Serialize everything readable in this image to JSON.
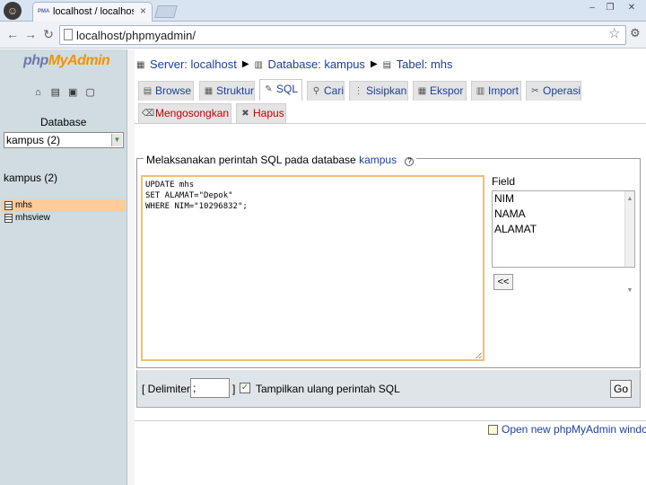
{
  "browser": {
    "tab_title": "localhost / localhost / kampus",
    "favicon_text": "PMA",
    "address": "localhost/phpmyadmin/",
    "tab_close": "×",
    "window_controls": [
      "–",
      "❐",
      "✕"
    ]
  },
  "sidebar": {
    "logo_php": "php",
    "logo_myadmin": "MyAdmin",
    "icons": [
      "home-icon",
      "sql-window-icon",
      "docs-icon",
      "query-icon"
    ],
    "database_label": "Database",
    "selected_database": "kampus (2)",
    "database_title": "kampus (2)",
    "tables": [
      {
        "name": "mhs",
        "active": true
      },
      {
        "name": "mhsview",
        "active": false
      }
    ]
  },
  "breadcrumb": {
    "server": "Server: localhost",
    "database": "Database: kampus",
    "table": "Tabel: mhs"
  },
  "tabs_row1": [
    {
      "label": "Browse",
      "icon": "browse-icon",
      "active": false
    },
    {
      "label": "Struktur",
      "icon": "structure-icon",
      "active": false
    },
    {
      "label": "SQL",
      "icon": "sql-icon",
      "active": true
    },
    {
      "label": "Cari",
      "icon": "search-icon",
      "active": false
    },
    {
      "label": "Sisipkan",
      "icon": "insert-icon",
      "active": false
    },
    {
      "label": "Ekspor",
      "icon": "export-icon",
      "active": false
    },
    {
      "label": "Import",
      "icon": "import-icon",
      "active": false
    },
    {
      "label": "Operasi",
      "icon": "operations-icon",
      "active": false
    }
  ],
  "tabs_row2": [
    {
      "label": "Mengosongkan",
      "icon": "empty-icon"
    },
    {
      "label": "Hapus",
      "icon": "drop-icon"
    }
  ],
  "sql_panel": {
    "legend_prefix": "Melaksanakan perintah SQL pada database",
    "legend_db": "kampus",
    "query_lines": [
      "UPDATE mhs",
      "SET ALAMAT=\"Depok\"",
      "WHERE NIM=\"10296832\";"
    ],
    "field_label": "Field",
    "fields": [
      "NIM",
      "NAMA",
      "ALAMAT"
    ],
    "insert_button": "<<"
  },
  "bottom": {
    "delimiter_label": "[ Delimiter",
    "delimiter_value": ";",
    "delimiter_close": "]",
    "show_query_label": "Tampilkan ulang perintah SQL",
    "show_query_checked": true,
    "go_button": "Go"
  },
  "footer": {
    "new_window_link": "Open new phpMyAdmin window"
  }
}
